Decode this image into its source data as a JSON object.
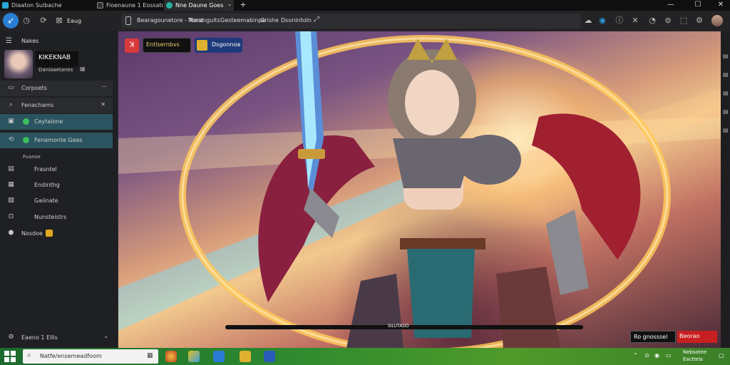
{
  "tabs": [
    {
      "label": "Diaaton Sulbache",
      "color": "#2aa7d8",
      "active": false
    },
    {
      "label": "Fioenaune 1 Eossatoun",
      "color": "#444",
      "active": false
    },
    {
      "label": "Nne Daune Goes",
      "color": "#2ab0a0",
      "active": true
    }
  ],
  "tab_new": "+",
  "window_controls": {
    "minimize": "—",
    "maximize": "☐",
    "close": "✕"
  },
  "toolbar": {
    "profile_label": "Eaug",
    "bookmarks": [
      "Bearagounetore - Toest",
      "Meranguits",
      "Gesteemabinpe",
      "Grishe",
      "Dsonintoln"
    ]
  },
  "sidebar": {
    "menu_label": "Nakes",
    "profile": {
      "name": "KIKEKNAB",
      "subtitle": "Daniaaetanes"
    },
    "items": [
      {
        "label": "Corpoets",
        "icon": "folder-icon",
        "type": "header"
      },
      {
        "label": "Fenachams",
        "icon": "search-icon",
        "type": "header"
      },
      {
        "label": "Ceytalone",
        "icon": "chat-icon",
        "type": "selected"
      },
      {
        "label": "Fenamonte Geas",
        "icon": "refresh-icon",
        "type": "selected"
      },
      {
        "label": "Fuanse",
        "icon": "",
        "type": "section"
      },
      {
        "label": "Frasntel",
        "icon": "image-icon",
        "type": "normal"
      },
      {
        "label": "Endinthg",
        "icon": "list-icon",
        "type": "normal"
      },
      {
        "label": "Gaiinate",
        "icon": "tag-icon",
        "type": "normal"
      },
      {
        "label": "Nunsteistrs",
        "icon": "dots-icon",
        "type": "normal"
      },
      {
        "label": "Nosdoe",
        "icon": "cube-icon",
        "type": "normal"
      }
    ],
    "footer_label": "Eaeno 1 Ellis"
  },
  "content": {
    "chip1": "Entlsernbvs",
    "chip2": "Dsgonnoa",
    "progress_label": "SILUTADD",
    "progress": 0.0,
    "bottom_left_btn": "Ro gnosssel",
    "bottom_right_btn": "Beorao"
  },
  "taskbar": {
    "search_text": "Natfe/ensemeadfoom",
    "date": "Eactteis",
    "time": "Nebsotee"
  }
}
